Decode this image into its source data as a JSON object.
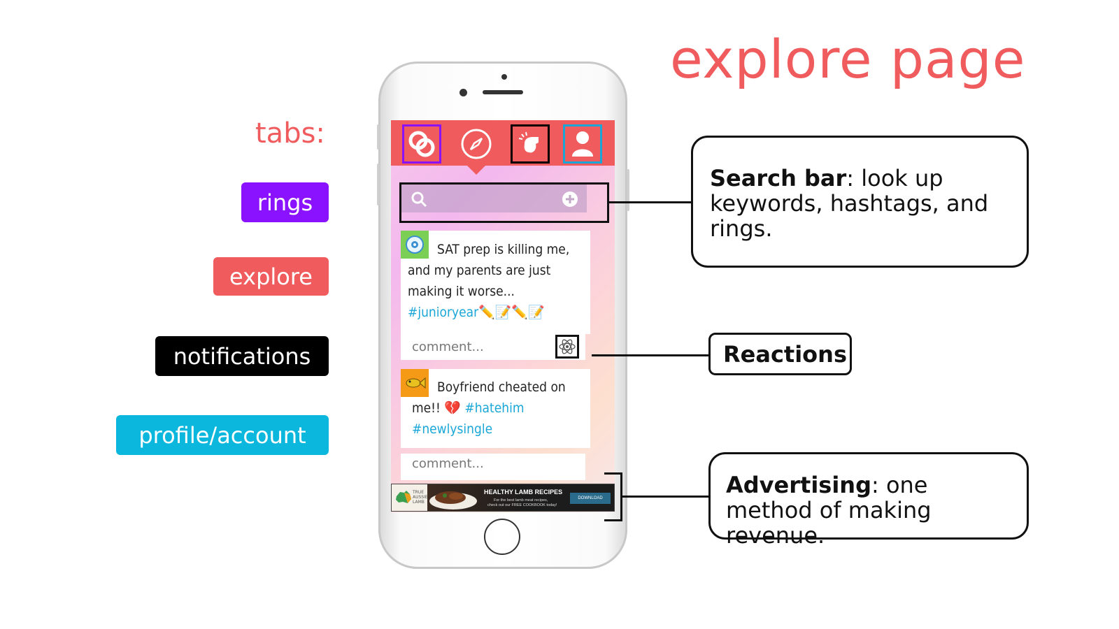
{
  "title": "explore page",
  "tabs_heading": "tabs:",
  "legend": [
    {
      "label": "rings",
      "color": "#8b12ff"
    },
    {
      "label": "explore",
      "color": "#f05c5e"
    },
    {
      "label": "notifications",
      "color": "#000000"
    },
    {
      "label": "profile/account",
      "color": "#0bb7dd"
    }
  ],
  "phone": {
    "tabs": [
      {
        "icon": "rings-icon",
        "outline": "#8b12ff"
      },
      {
        "icon": "compass-icon",
        "outline": ""
      },
      {
        "icon": "whistle-icon",
        "outline": "#000000"
      },
      {
        "icon": "profile-icon",
        "outline": "#1aa7d8"
      }
    ],
    "posts": [
      {
        "avatar": "eyeball-avatar",
        "avatar_color": "#7bcf54",
        "text_lines": [
          "SAT prep is killing me,",
          "and my parents are just",
          "making it worse..."
        ],
        "hashtags": "#junioryear",
        "emoji": "✏️📝✏️📝",
        "comment_placeholder": "comment..."
      },
      {
        "avatar": "fish-avatar",
        "avatar_color": "#f49a16",
        "text_lines": [
          "Boyfriend cheated on"
        ],
        "line2_text": "me!! 💔 ",
        "line2_tag": "#hatehim",
        "line3_tag": "#newlysingle",
        "comment_placeholder": "comment..."
      }
    ],
    "ad": {
      "brand_line1": "TRUE",
      "brand_line2": "AUSSIE",
      "brand_line3": "LAMB",
      "headline": "HEALTHY LAMB RECIPES",
      "subline1": "For the best lamb meat recipes,",
      "subline2": "check out our FREE COOKBOOK today!",
      "cta": "DOWNLOAD"
    }
  },
  "callouts": {
    "search": {
      "bold": "Search bar",
      "rest": ": look up keywords, hashtags, and rings."
    },
    "reactions": {
      "bold": "Reactions"
    },
    "advertising": {
      "bold": "Advertising",
      "rest": ": one method of making revenue."
    }
  }
}
